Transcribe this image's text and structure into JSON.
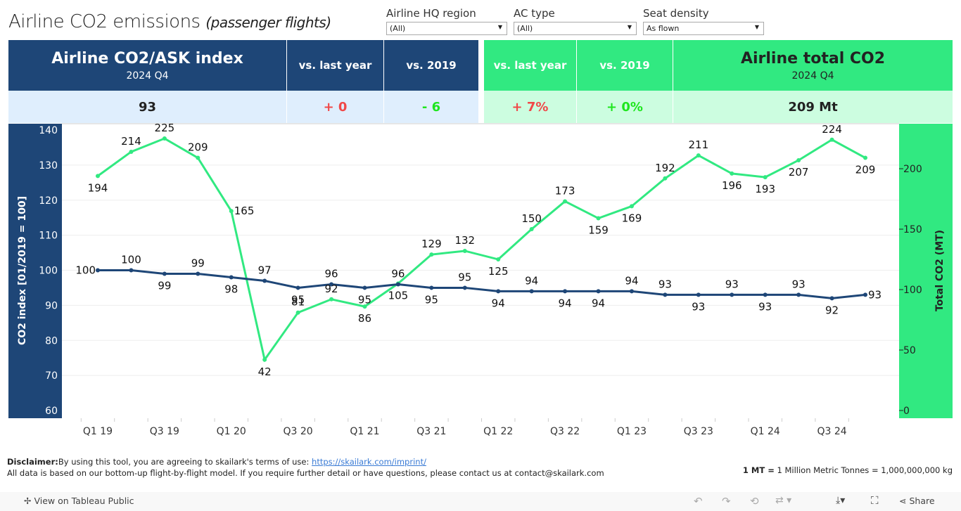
{
  "title": {
    "main": "Airline CO2 emissions",
    "sub": "(passenger flights)"
  },
  "filters": [
    {
      "label": "Airline HQ region",
      "value": "(All)"
    },
    {
      "label": "AC type",
      "value": "(All)"
    },
    {
      "label": "Seat density",
      "value": "As flown"
    }
  ],
  "kpi": {
    "index_title": "Airline CO2/ASK index",
    "index_period": "2024 Q4",
    "index_value": "93",
    "index_vs_ly_label": "vs. last year",
    "index_vs_ly": "+ 0",
    "index_vs_2019_label": "vs. 2019",
    "index_vs_2019": "- 6",
    "total_vs_ly_label": "vs. last year",
    "total_vs_ly": "+ 7%",
    "total_vs_2019_label": "vs. 2019",
    "total_vs_2019": "+ 0%",
    "total_title": "Airline total CO2",
    "total_period": "2024 Q4",
    "total_value": "209 Mt"
  },
  "colors": {
    "index": "#1e4677",
    "total": "#31e981",
    "negative": "#f04848",
    "positive": "#1ee61e"
  },
  "chart_data": {
    "type": "line",
    "x": [
      "Q1 19",
      "Q2 19",
      "Q3 19",
      "Q4 19",
      "Q1 20",
      "Q2 20",
      "Q3 20",
      "Q4 20",
      "Q1 21",
      "Q2 21",
      "Q3 21",
      "Q4 21",
      "Q1 22",
      "Q2 22",
      "Q3 22",
      "Q4 22",
      "Q1 23",
      "Q2 23",
      "Q3 23",
      "Q4 23",
      "Q1 24",
      "Q2 24",
      "Q3 24",
      "Q4 24"
    ],
    "xtick_labels": [
      "Q1 19",
      "Q3 19",
      "Q1 20",
      "Q3 20",
      "Q1 21",
      "Q3 21",
      "Q1 22",
      "Q3 22",
      "Q1 23",
      "Q3 23",
      "Q1 24",
      "Q3 24"
    ],
    "ylabel_left": "CO2 index [01/2019 = 100]",
    "ylim_left": [
      60,
      140
    ],
    "yticks_left": [
      60,
      70,
      80,
      90,
      100,
      110,
      120,
      130,
      140
    ],
    "ylabel_right": "Total CO2 (MT)",
    "ylim_right": [
      0,
      232
    ],
    "yticks_right": [
      0,
      50,
      100,
      150,
      200
    ],
    "grid": true,
    "series": [
      {
        "axis": "left",
        "color": "#1e4677",
        "values": [
          100,
          100,
          99,
          99,
          98,
          97,
          95,
          96,
          95,
          96,
          95,
          95,
          94,
          94,
          94,
          94,
          94,
          93,
          93,
          93,
          93,
          93,
          92,
          93
        ]
      },
      {
        "axis": "right",
        "color": "#31e981",
        "values": [
          194,
          214,
          225,
          209,
          165,
          42,
          81,
          92,
          86,
          105,
          129,
          132,
          125,
          150,
          173,
          159,
          169,
          192,
          211,
          196,
          193,
          207,
          224,
          209
        ]
      }
    ]
  },
  "footer": {
    "disclaimer_label": "Disclaimer:",
    "disclaimer_text": "By using this tool, you are agreeing to skailark's terms of use:",
    "link": "https://skailark.com/imprint/",
    "line2": "All data is based on our bottom-up flight-by-flight model. If you require further detail or have questions, please contact us at contact@skailark.com",
    "mt_label": "1 MT =",
    "mt_text": "1 Million Metric Tonnes = 1,000,000,000 kg"
  },
  "toolbar": {
    "view": "View on Tableau Public",
    "share": "Share"
  }
}
